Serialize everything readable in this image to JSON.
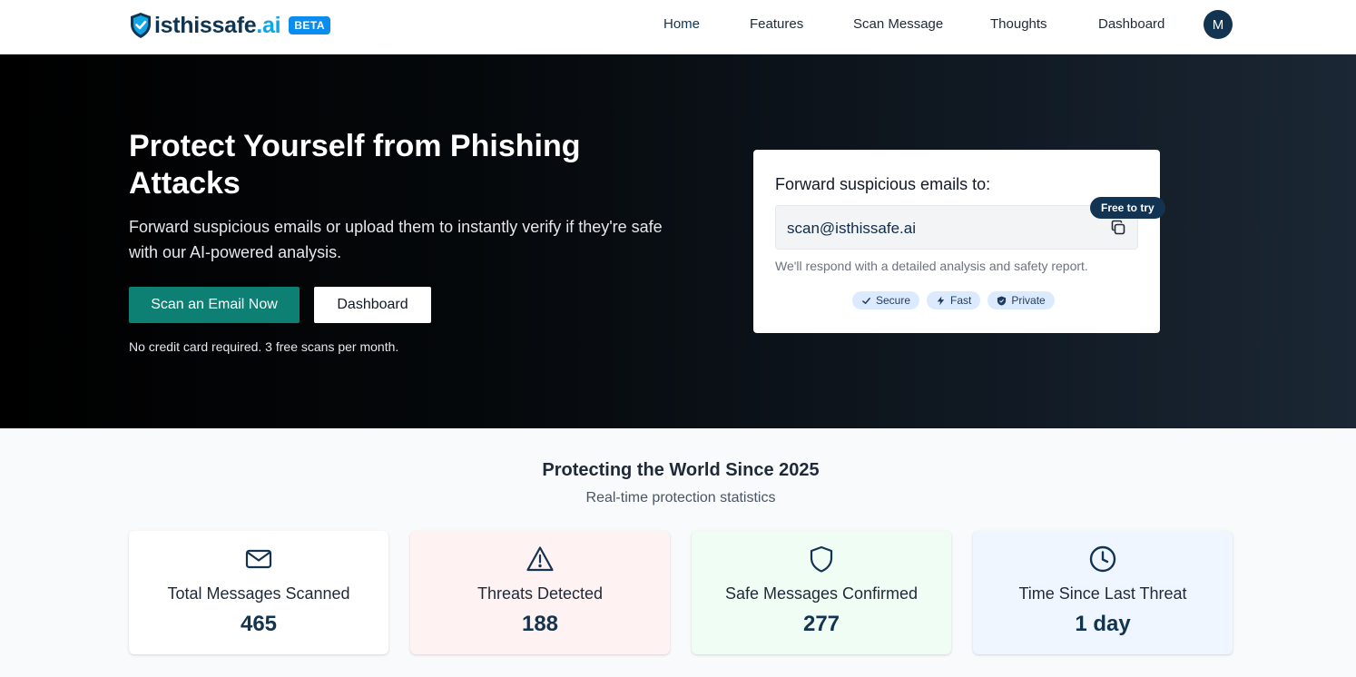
{
  "header": {
    "brand_part1": "isthis",
    "brand_part2": "safe",
    "brand_part3": ".ai",
    "beta_label": "BETA",
    "nav": [
      "Home",
      "Features",
      "Scan Message",
      "Thoughts",
      "Dashboard"
    ],
    "active_nav": "Home",
    "avatar_initial": "M"
  },
  "hero": {
    "title": "Protect Yourself from Phishing Attacks",
    "subtitle": "Forward suspicious emails or upload them to instantly verify if they're safe with our AI-powered analysis.",
    "primary_button": "Scan an Email Now",
    "secondary_button": "Dashboard",
    "note": "No credit card required. 3 free scans per month."
  },
  "forward_card": {
    "pill": "Free to try",
    "title": "Forward suspicious emails to:",
    "email": "scan@isthissafe.ai",
    "note": "We'll respond with a detailed analysis and safety report.",
    "tags": [
      "Secure",
      "Fast",
      "Private"
    ]
  },
  "stats": {
    "title": "Protecting the World Since 2025",
    "subtitle": "Real-time protection statistics",
    "items": [
      {
        "label": "Total Messages Scanned",
        "value": "465",
        "icon": "mail-icon",
        "bg": "#ffffff"
      },
      {
        "label": "Threats Detected",
        "value": "188",
        "icon": "warning-icon",
        "bg": "#fef2f2"
      },
      {
        "label": "Safe Messages Confirmed",
        "value": "277",
        "icon": "shield-icon",
        "bg": "#f0fdf4"
      },
      {
        "label": "Time Since Last Threat",
        "value": "1 day",
        "icon": "clock-icon",
        "bg": "#eff6ff"
      }
    ]
  },
  "colors": {
    "primary_teal": "#0d7f73",
    "navy": "#133451",
    "brand_blue": "#0ea5e9",
    "beta_blue": "#0b8df0"
  }
}
